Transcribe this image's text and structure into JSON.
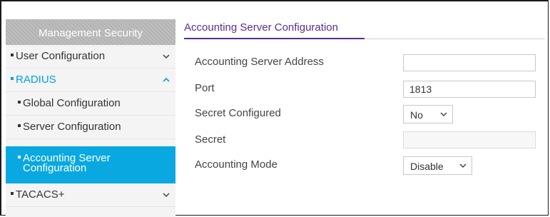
{
  "sidebar": {
    "header": "Management Security",
    "items": [
      {
        "label": "User Configuration",
        "expanded": false
      },
      {
        "label": "RADIUS",
        "expanded": true
      },
      {
        "label": "Global Configuration"
      },
      {
        "label": "Server Configuration"
      },
      {
        "label_line1": "Accounting Server",
        "label_line2": "Configuration",
        "active": true
      },
      {
        "label": "TACACS+",
        "expanded": false
      }
    ]
  },
  "main": {
    "section_title": "Accounting Server Configuration",
    "fields": {
      "server_address": {
        "label": "Accounting Server Address",
        "value": ""
      },
      "port": {
        "label": "Port",
        "value": "1813"
      },
      "secret_configured": {
        "label": "Secret Configured",
        "value": "No"
      },
      "secret": {
        "label": "Secret",
        "value": ""
      },
      "accounting_mode": {
        "label": "Accounting Mode",
        "value": "Disable"
      }
    }
  },
  "colors": {
    "accent_purple": "#5c2d91",
    "active_blue": "#09a8e1",
    "link_blue": "#00a0e0"
  }
}
